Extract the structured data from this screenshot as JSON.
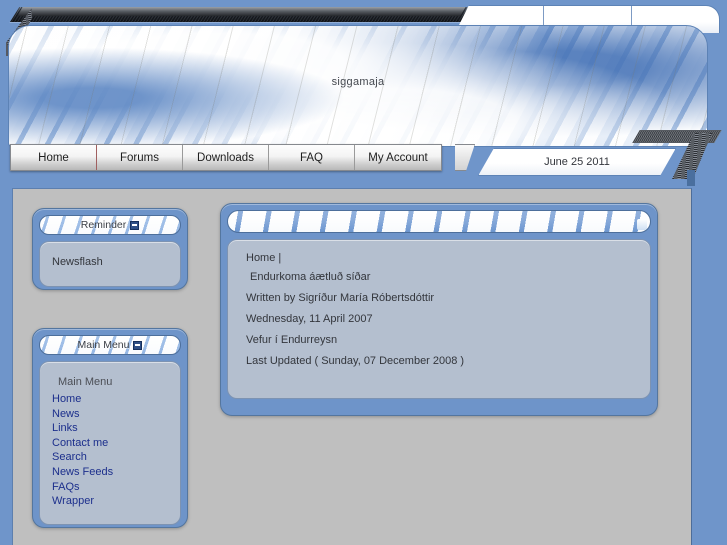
{
  "site": {
    "title": "siggamaja",
    "date": "June 25 2011"
  },
  "header": {
    "top_tabs": [
      "",
      "",
      ""
    ]
  },
  "nav": {
    "items": [
      {
        "label": "Home"
      },
      {
        "label": "Forums"
      },
      {
        "label": "Downloads"
      },
      {
        "label": "FAQ"
      },
      {
        "label": "My Account"
      }
    ]
  },
  "sidebar": {
    "modules": [
      {
        "title": "Reminder",
        "collapse_icon": "minus-box-icon",
        "body_text": "Newsflash"
      },
      {
        "title": "Main Menu",
        "collapse_icon": "minus-box-icon",
        "caption": "Main Menu",
        "items": [
          "Home",
          "News",
          "Links",
          "Contact me",
          "Search",
          "News Feeds",
          "FAQs",
          "Wrapper"
        ]
      }
    ]
  },
  "content": {
    "breadcrumb": "Home |",
    "article_title": "Endurkoma áætluð síðar",
    "author_line": "Written by Sigríður María Róbertsdóttir",
    "date_line": "Wednesday, 11 April 2007",
    "body_line": "Vefur í Endurreysn",
    "updated_line": "Last Updated ( Sunday, 07 December 2008 )"
  },
  "colors": {
    "frame_blue": "#6f95ca",
    "panel_blue": "#6e94c9",
    "panel_body": "#b4bfcf",
    "page_gray": "#bfbfbf",
    "link_blue": "#1c2f8c",
    "text_dark": "#33363c"
  }
}
